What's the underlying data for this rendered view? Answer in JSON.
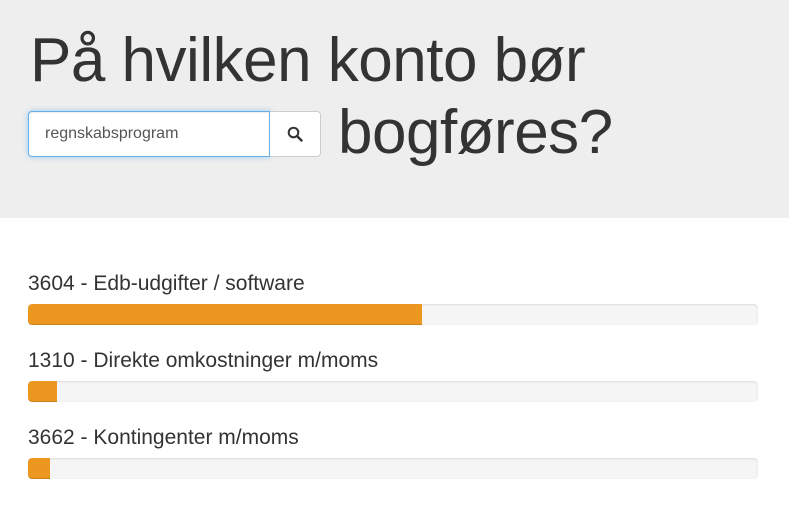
{
  "header": {
    "title_line1": "På hvilken konto bør",
    "title_line2": "bogføres?"
  },
  "search": {
    "value": "regnskabsprogram",
    "button_icon": "search-icon"
  },
  "results": [
    {
      "label": "3604 - Edb-udgifter / software",
      "fraction": 0.54
    },
    {
      "label": "1310 - Direkte omkostninger m/moms",
      "fraction": 0.04
    },
    {
      "label": "3662 - Kontingenter m/moms",
      "fraction": 0.03
    }
  ],
  "colors": {
    "hero_background": "#eeeeee",
    "bar_fill": "#ec971f",
    "bar_track": "#f5f5f5",
    "focus_border": "#66afe9"
  }
}
